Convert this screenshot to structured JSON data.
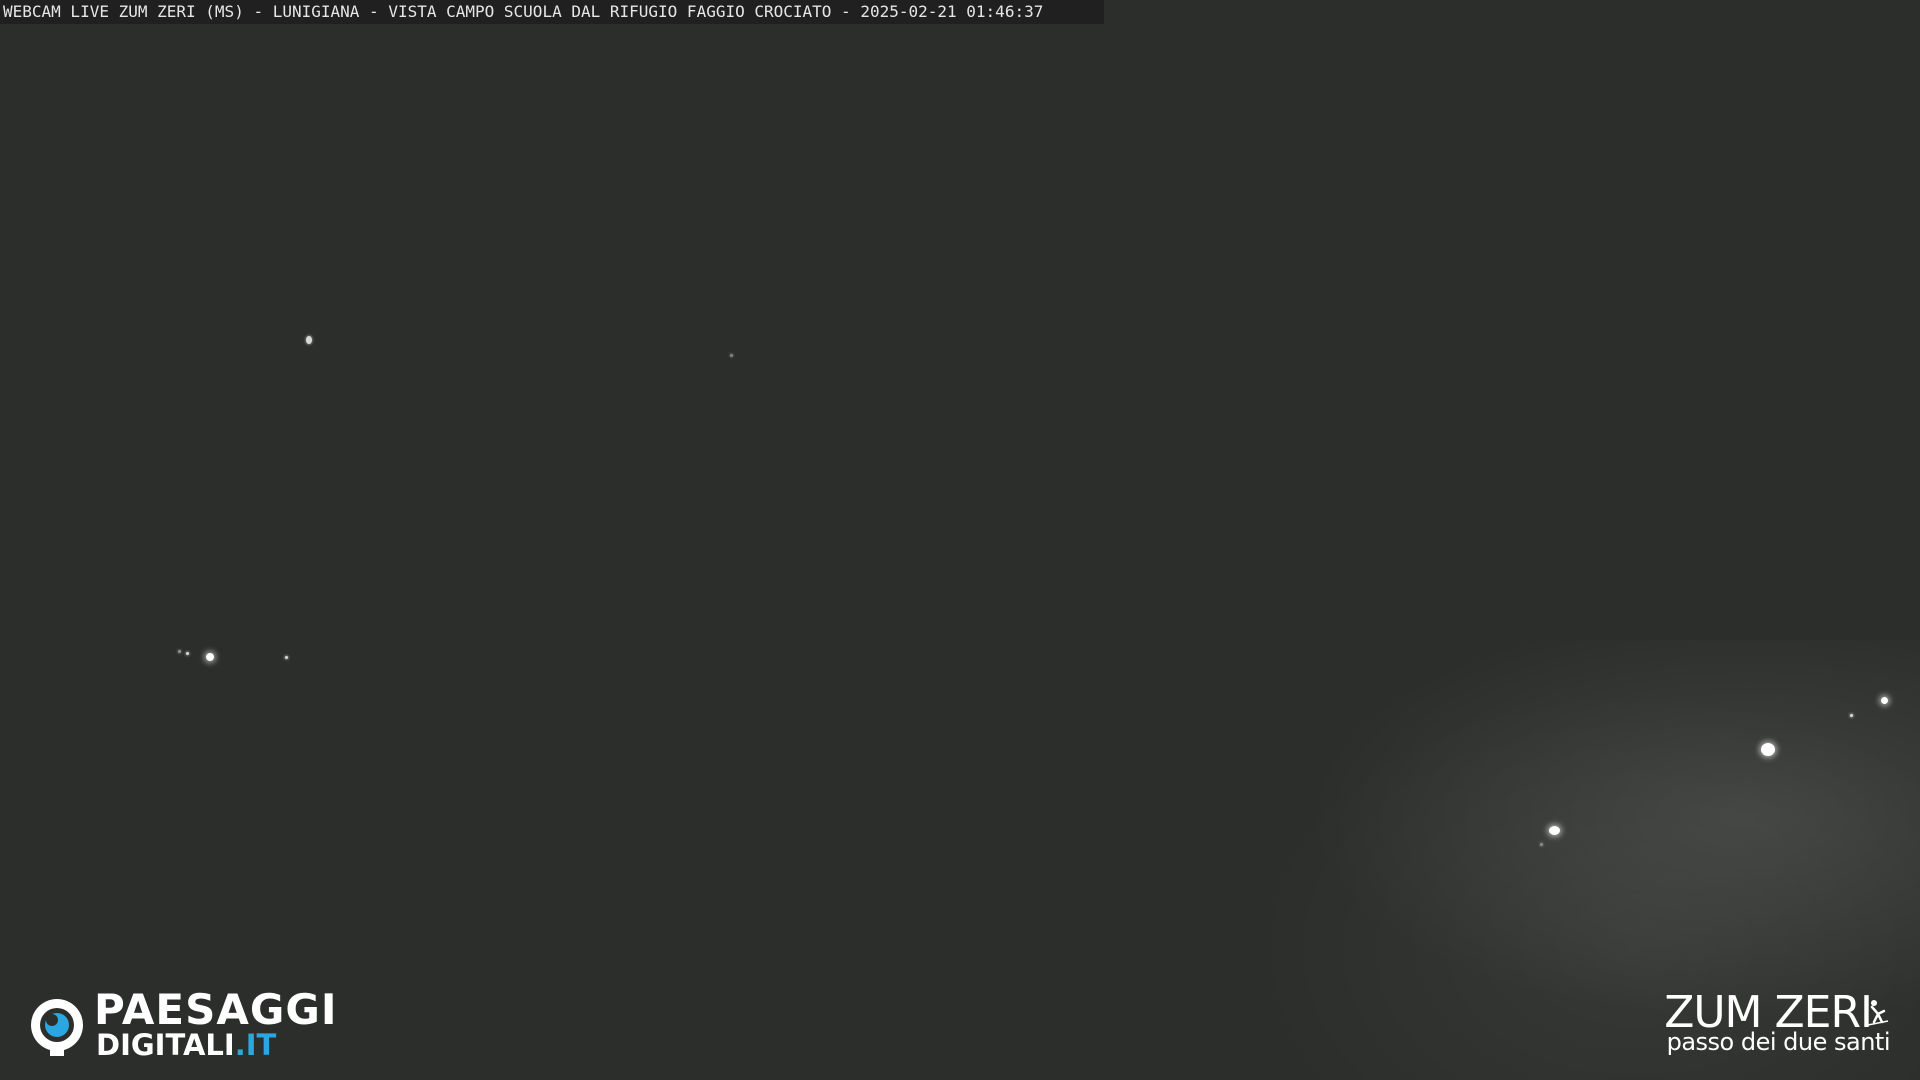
{
  "overlay": {
    "caption": "WEBCAM LIVE ZUM ZERI (MS) - LUNIGIANA - VISTA CAMPO SCUOLA DAL RIFUGIO FAGGIO CROCIATO - 2025-02-21 01:46:37"
  },
  "logos": {
    "left": {
      "line1": "PAESAGGI",
      "line2_main": "DIGITALI",
      "line2_suffix": ".IT",
      "icon": "eye-icon"
    },
    "right": {
      "line1": "ZUM ZERI",
      "line2": "passo dei due santi",
      "icon": "skier-icon"
    }
  },
  "colors": {
    "sky": "#2c2e2c",
    "accent": "#2aa6e0",
    "text": "#ffffff"
  }
}
